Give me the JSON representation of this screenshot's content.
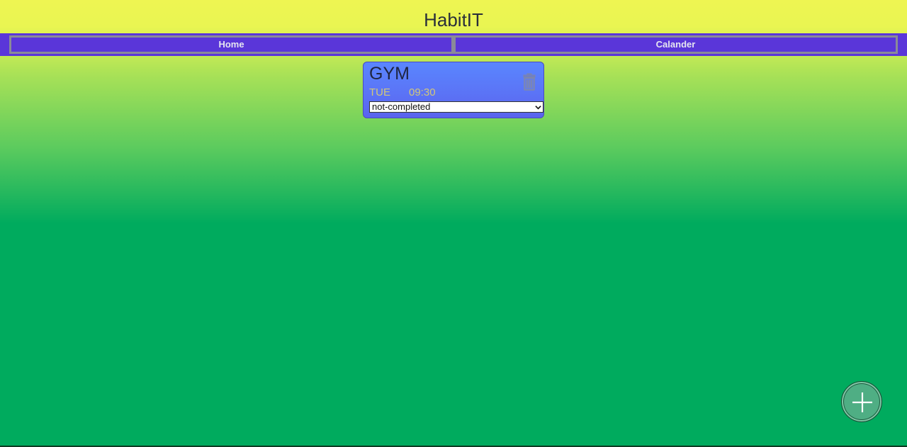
{
  "app": {
    "title": "HabitIT"
  },
  "nav": {
    "tabs": [
      {
        "label": "Home"
      },
      {
        "label": "Calander"
      }
    ]
  },
  "habits": [
    {
      "name": "GYM",
      "day": "TUE",
      "time": "09:30",
      "status": "not-completed"
    }
  ],
  "icons": {
    "delete": "trash-icon",
    "add": "plus-icon",
    "dropdown": "chevron-down-icon"
  },
  "colors": {
    "nav_bg": "#5a36d9",
    "card_bg": "#5b74f6",
    "accent_text": "#d3c77a",
    "add_button": "#4fae84"
  }
}
